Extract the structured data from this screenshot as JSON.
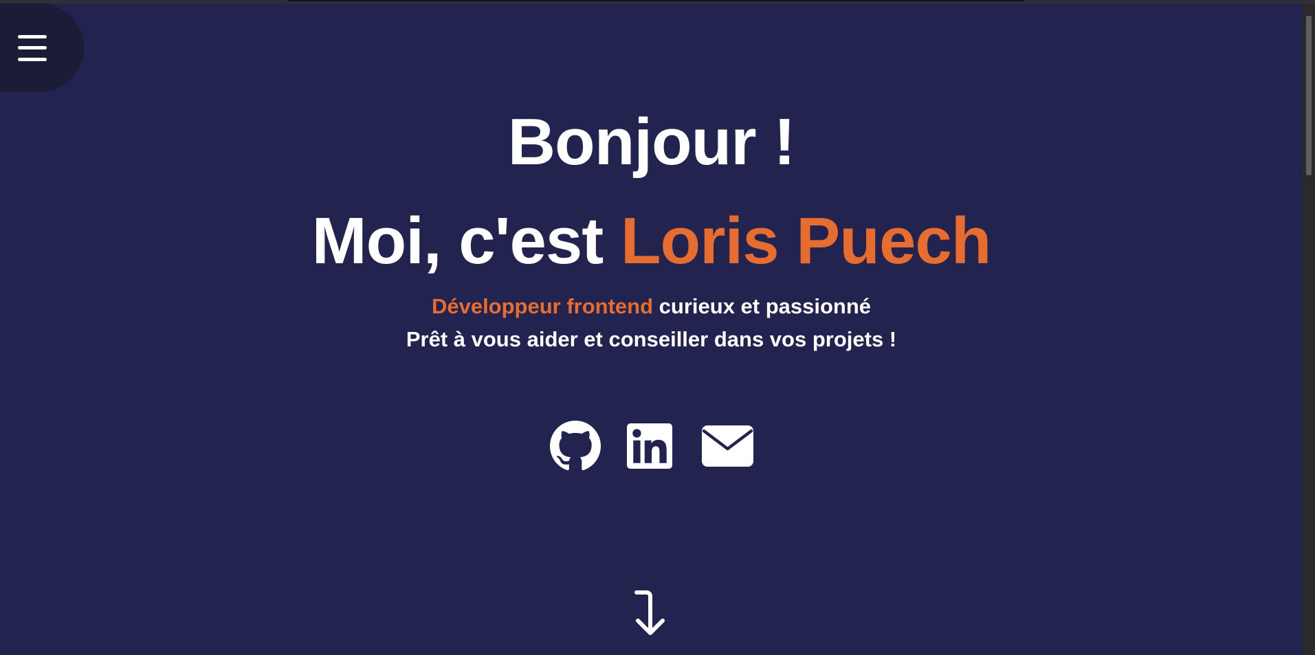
{
  "nav": {
    "menu_icon": "hamburger-menu-icon"
  },
  "hero": {
    "greeting": "Bonjour !",
    "intro_prefix": "Moi, c'est ",
    "name": "Loris Puech",
    "role_highlight": "Développeur frontend",
    "role_rest": " curieux et passionné",
    "subline": "Prêt à vous aider et conseiller dans vos projets !"
  },
  "socials": [
    {
      "icon": "github-icon",
      "label": "GitHub"
    },
    {
      "icon": "linkedin-icon",
      "label": "LinkedIn"
    },
    {
      "icon": "mail-icon",
      "label": "Email"
    }
  ],
  "scroll": {
    "icon": "arrow-down-icon"
  },
  "colors": {
    "background": "#23234f",
    "accent": "#e66c30",
    "text": "#ffffff",
    "menu_background": "#1b1c36"
  }
}
